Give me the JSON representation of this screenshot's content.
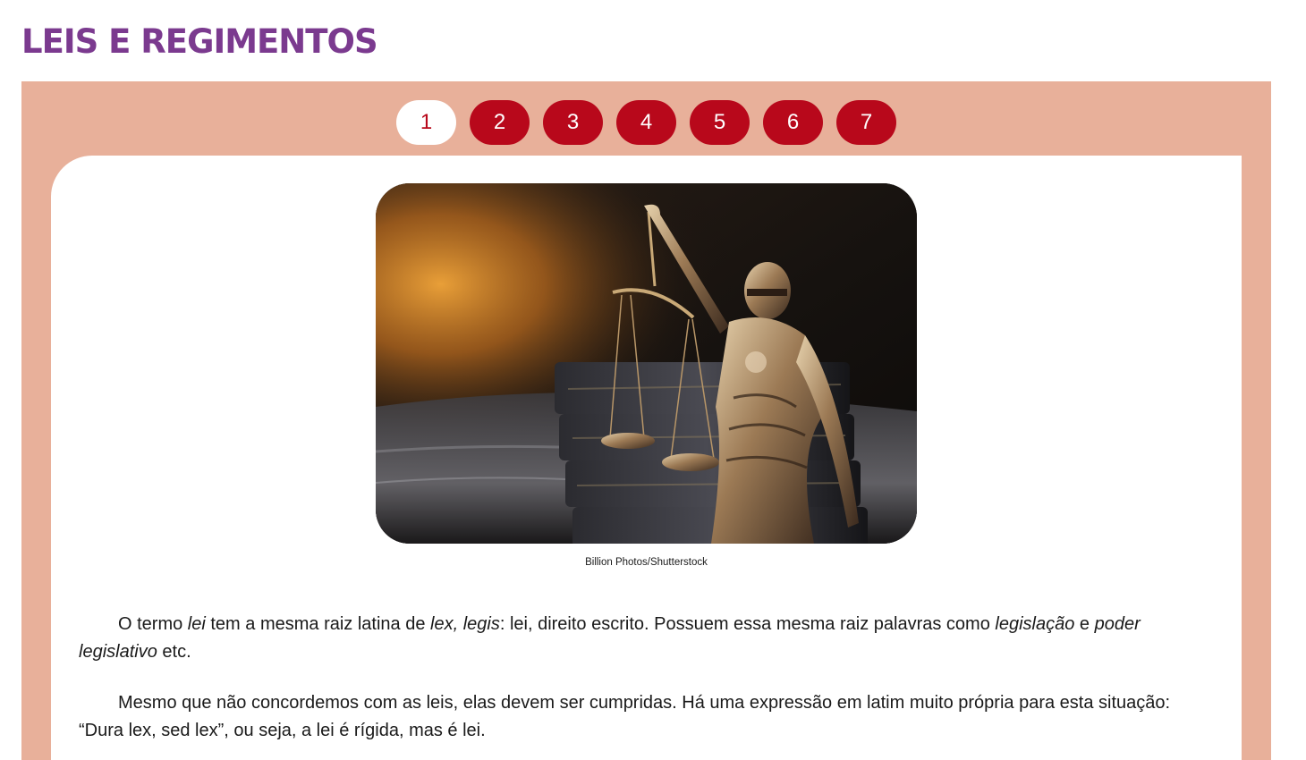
{
  "page": {
    "title": "LEIS E REGIMENTOS"
  },
  "pagination": {
    "items": [
      {
        "label": "1",
        "active": true
      },
      {
        "label": "2",
        "active": false
      },
      {
        "label": "3",
        "active": false
      },
      {
        "label": "4",
        "active": false
      },
      {
        "label": "5",
        "active": false
      },
      {
        "label": "6",
        "active": false
      },
      {
        "label": "7",
        "active": false
      }
    ]
  },
  "image": {
    "credit": "Billion Photos/Shutterstock"
  },
  "paragraphs": [
    {
      "runs": [
        {
          "text": "O termo ",
          "italic": false
        },
        {
          "text": "lei",
          "italic": true
        },
        {
          "text": " tem a mesma raiz latina de ",
          "italic": false
        },
        {
          "text": "lex, legis",
          "italic": true
        },
        {
          "text": ": lei, direito escrito. Possuem essa mesma raiz palavras como ",
          "italic": false
        },
        {
          "text": "legislação",
          "italic": true
        },
        {
          "text": " e ",
          "italic": false
        },
        {
          "text": "poder legislativo",
          "italic": true
        },
        {
          "text": " etc.",
          "italic": false
        }
      ]
    },
    {
      "runs": [
        {
          "text": "Mesmo que não concordemos com as leis, elas devem ser cumpridas. Há uma expressão em latim muito própria para esta situação: “Dura lex, sed lex”, ou seja, a lei é rígida, mas é lei.",
          "italic": false
        }
      ]
    }
  ],
  "colors": {
    "title": "#7b3a8f",
    "panel": "#e8b09a",
    "button": "#b8081b",
    "button_active_bg": "#ffffff"
  }
}
